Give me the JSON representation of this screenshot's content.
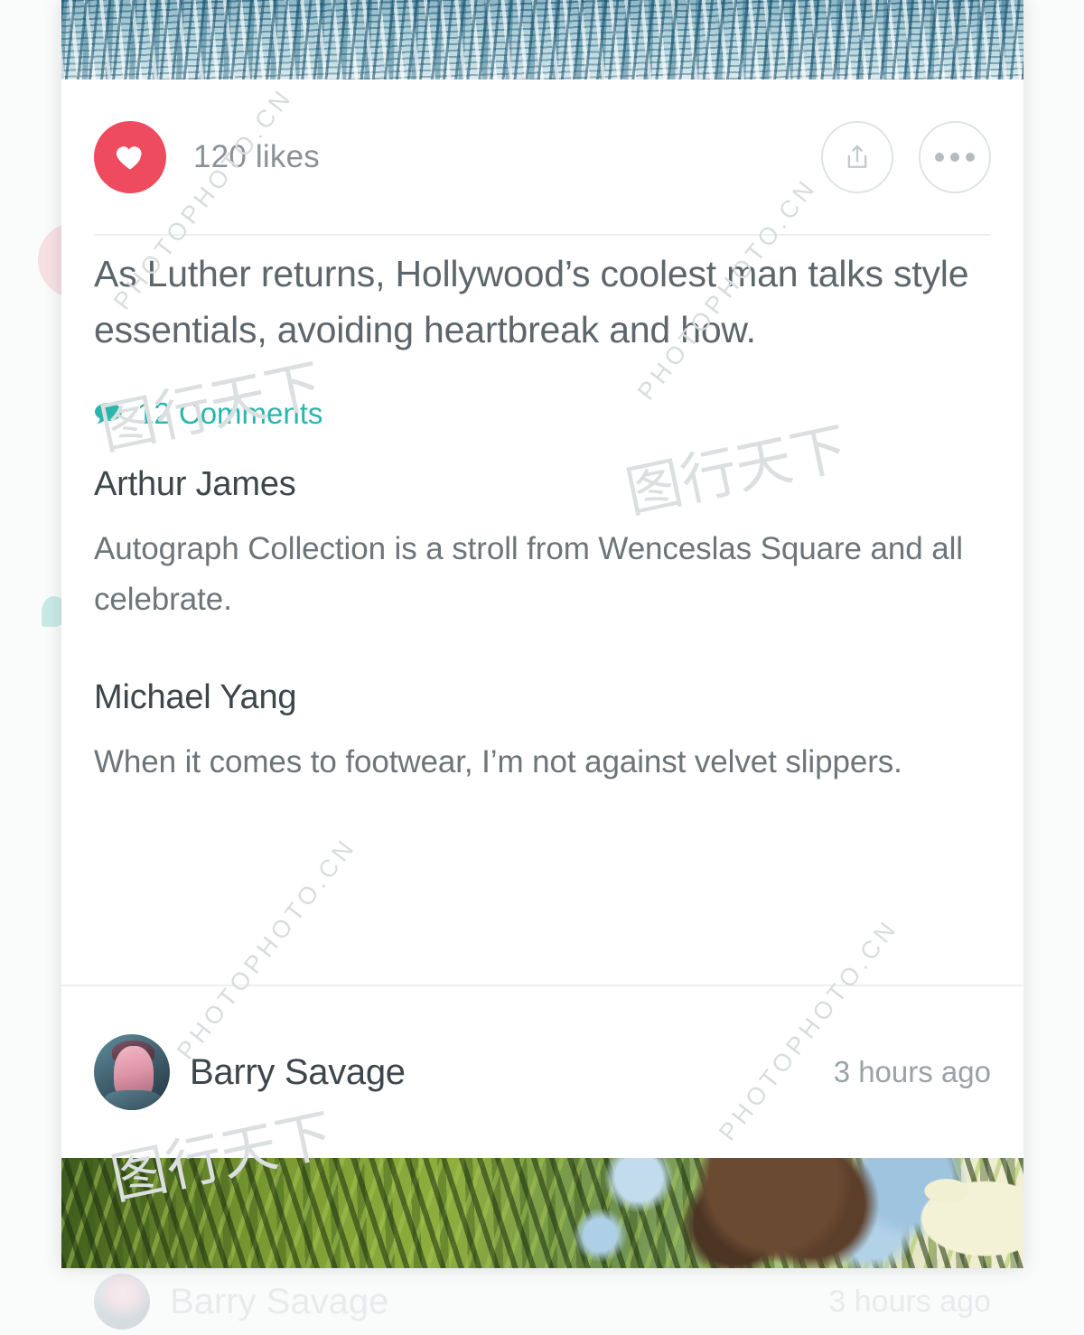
{
  "post": {
    "hero_top_alt": "ocean-water-photo",
    "hero_bottom_alt": "tree-canopy-photo",
    "likes_label": "120 likes",
    "heart_icon": "heart-icon",
    "share_icon": "share-icon",
    "more_icon": "more-options-icon",
    "headline": "As Luther returns, Hollywood’s coolest man talks style essentials, avoiding heartbreak and how.",
    "comments": {
      "icon": "comment-bubble-icon",
      "count_label": "12 Comments",
      "items": [
        {
          "author": "Arthur James",
          "text": "Autograph Collection is a stroll from Wenceslas Square and all celebrate."
        },
        {
          "author": "Michael Yang",
          "text": "When it comes to footwear, I’m not against velvet slippers."
        }
      ]
    },
    "footer": {
      "avatar": "user-avatar",
      "author": "Barry Savage",
      "timestamp": "3 hours ago"
    }
  },
  "background_ghost": {
    "author": "Barry Savage",
    "timestamp": "3 hours ago"
  },
  "watermarks": {
    "latin": "PHOTOPHOTO.CN",
    "cn": "图行天下"
  },
  "colors": {
    "like_red": "#ee4b5e",
    "comment_teal": "#2bb5ad",
    "headline_gray": "#5d666b",
    "muted_gray": "#9aa2a6",
    "card_white": "#ffffff",
    "divider": "#eeeff1"
  }
}
